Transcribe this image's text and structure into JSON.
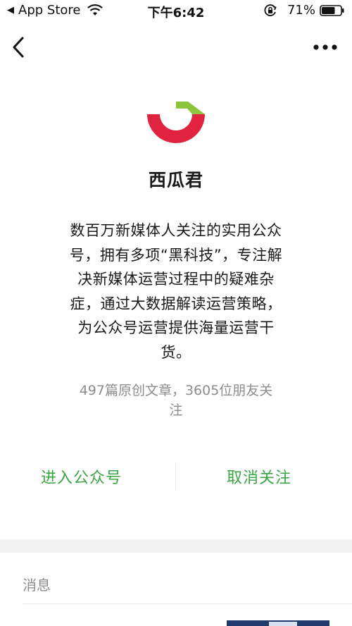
{
  "status_bar": {
    "back_app": "App Store",
    "time": "下午6:42",
    "battery_percent": "71%",
    "battery_level": 0.71
  },
  "nav": {
    "back_icon": "chevron-left-icon",
    "more_icon": "more-dots-icon"
  },
  "profile": {
    "name": "西瓜君",
    "description_lines": [
      "数百万新媒体人关注的实用公众",
      "号，拥有多项“黑科技”，专注解",
      "决新媒体运营过程中的疑难杂",
      "症，通过大数据解读运营策略，",
      "为公众号运营提供海量运营干",
      "货。"
    ],
    "stats_lines": [
      "497篇原创文章，3605位朋友关",
      "注"
    ]
  },
  "actions": {
    "enter": "进入公众号",
    "unfollow": "取消关注",
    "accent_color": "#3aa544"
  },
  "messages": {
    "label": "消息"
  },
  "colors": {
    "logo_red": "#e0243f",
    "logo_green": "#8cc43c"
  }
}
